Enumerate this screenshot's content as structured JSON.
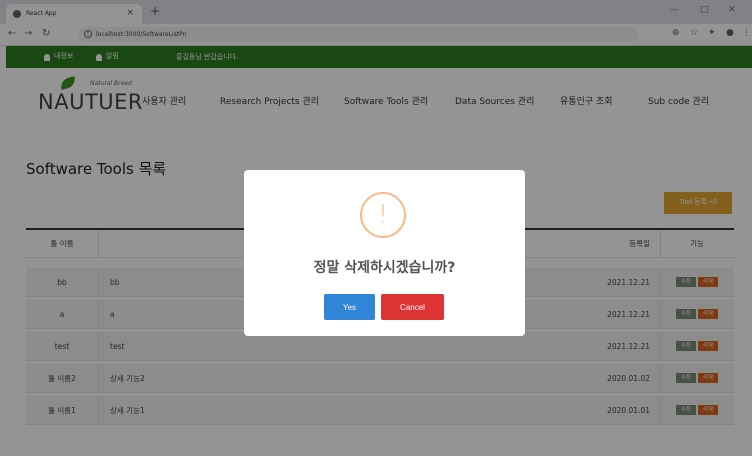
{
  "browser": {
    "tab_title": "React App",
    "url": "localhost:3000/SoftwareListPn",
    "close_glyph": "×",
    "new_tab_glyph": "+"
  },
  "topbar": {
    "my_info": "내정보",
    "notice": "알림",
    "welcome": "홍길동님 반갑습니다."
  },
  "logo": {
    "name": "NAUTUER",
    "tagline": "Natural Breed"
  },
  "nav": {
    "items": [
      "사용자 관리",
      "Research Projects 관리",
      "Software Tools 관리",
      "Data Sources 관리",
      "유통인구 조회",
      "Sub code 관리"
    ]
  },
  "page": {
    "title": "Software Tools 목록",
    "add_button": "Tool 등록 +0"
  },
  "table": {
    "headers": [
      "툴 이름",
      "",
      "등록일",
      "기능"
    ],
    "edit_label": "수정",
    "delete_label": "삭제",
    "rows": [
      {
        "name": "bb",
        "desc": "bb",
        "date": "2021.12.21"
      },
      {
        "name": "a",
        "desc": "a",
        "date": "2021.12.21"
      },
      {
        "name": "test",
        "desc": "test",
        "date": "2021.12.21"
      },
      {
        "name": "툴 이름2",
        "desc": "상세 기능2",
        "date": "2020.01.02"
      },
      {
        "name": "툴 이름1",
        "desc": "상세 기능1",
        "date": "2020.01.01"
      }
    ]
  },
  "dialog": {
    "icon_glyph": "!",
    "message": "정말 삭제하시겠습니까?",
    "confirm": "Yes",
    "cancel": "Cancel"
  }
}
